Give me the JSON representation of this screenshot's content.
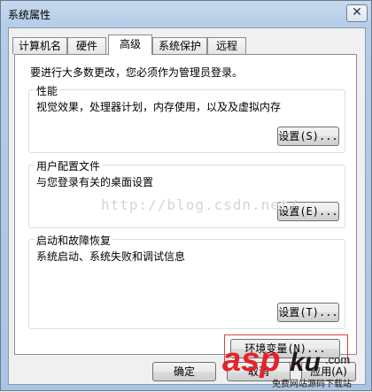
{
  "window": {
    "title": "系统属性",
    "close_glyph": "✕"
  },
  "tabs": [
    {
      "label": "计算机名",
      "active": false
    },
    {
      "label": "硬件",
      "active": false
    },
    {
      "label": "高级",
      "active": true
    },
    {
      "label": "系统保护",
      "active": false
    },
    {
      "label": "远程",
      "active": false
    }
  ],
  "panel": {
    "intro": "要进行大多数更改，您必须作为管理员登录。",
    "performance": {
      "title": "性能",
      "desc": "视觉效果，处理器计划，内存使用，以及及虚拟内存",
      "button": "设置(S)..."
    },
    "user_profiles": {
      "title": "用户配置文件",
      "desc": "与您登录有关的桌面设置",
      "button": "设置(E)..."
    },
    "startup_recovery": {
      "title": "启动和故障恢复",
      "desc": "系统启动、系统失败和调试信息",
      "button": "设置(T)..."
    },
    "env_button": "环境变量(N)..."
  },
  "footer": {
    "ok": "确定",
    "cancel": "取消",
    "apply": "应用(A)"
  },
  "watermark": "http://blog.csdn.net/",
  "logo": {
    "text": "aspku",
    "sub": "免费网站源码下载站",
    "com": ".com",
    "colors": {
      "asp": "#e8212b",
      "ku": "#1a1a1a",
      "sub": "#1a1a1a"
    }
  },
  "colors": {
    "highlight": "#e0403a",
    "titlebar": "#b4cce8"
  }
}
